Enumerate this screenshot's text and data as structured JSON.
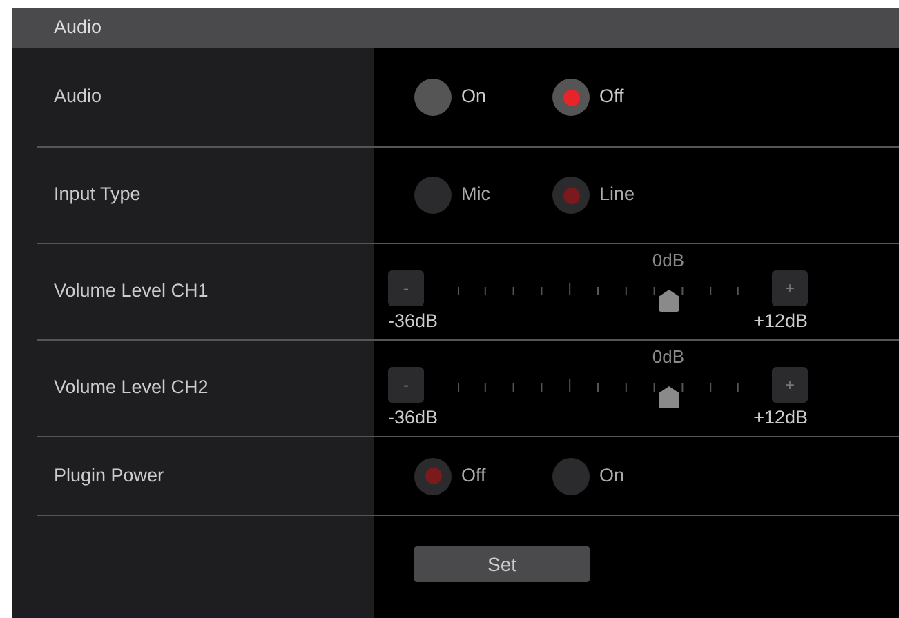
{
  "section": {
    "title": "Audio"
  },
  "settings": [
    {
      "kind": "radio",
      "label": "Audio",
      "disabled": false,
      "options": [
        {
          "label": "On",
          "selected": false
        },
        {
          "label": "Off",
          "selected": true
        }
      ]
    },
    {
      "kind": "radio",
      "label": "Input Type",
      "disabled": true,
      "options": [
        {
          "label": "Mic",
          "selected": false
        },
        {
          "label": "Line",
          "selected": true
        }
      ]
    },
    {
      "kind": "slider",
      "label": "Volume Level CH1",
      "disabled": true,
      "level": 0.75,
      "center_label": "0dB",
      "min_label": "-36dB",
      "max_label": "+12dB",
      "minus": "-",
      "plus": "+"
    },
    {
      "kind": "slider",
      "label": "Volume Level CH2",
      "disabled": true,
      "level": 0.75,
      "center_label": "0dB",
      "min_label": "-36dB",
      "max_label": "+12dB",
      "minus": "-",
      "plus": "+"
    },
    {
      "kind": "radio",
      "label": "Plugin Power",
      "disabled": true,
      "options": [
        {
          "label": "Off",
          "selected": true
        },
        {
          "label": "On",
          "selected": false
        }
      ]
    }
  ],
  "set_button": "Set"
}
